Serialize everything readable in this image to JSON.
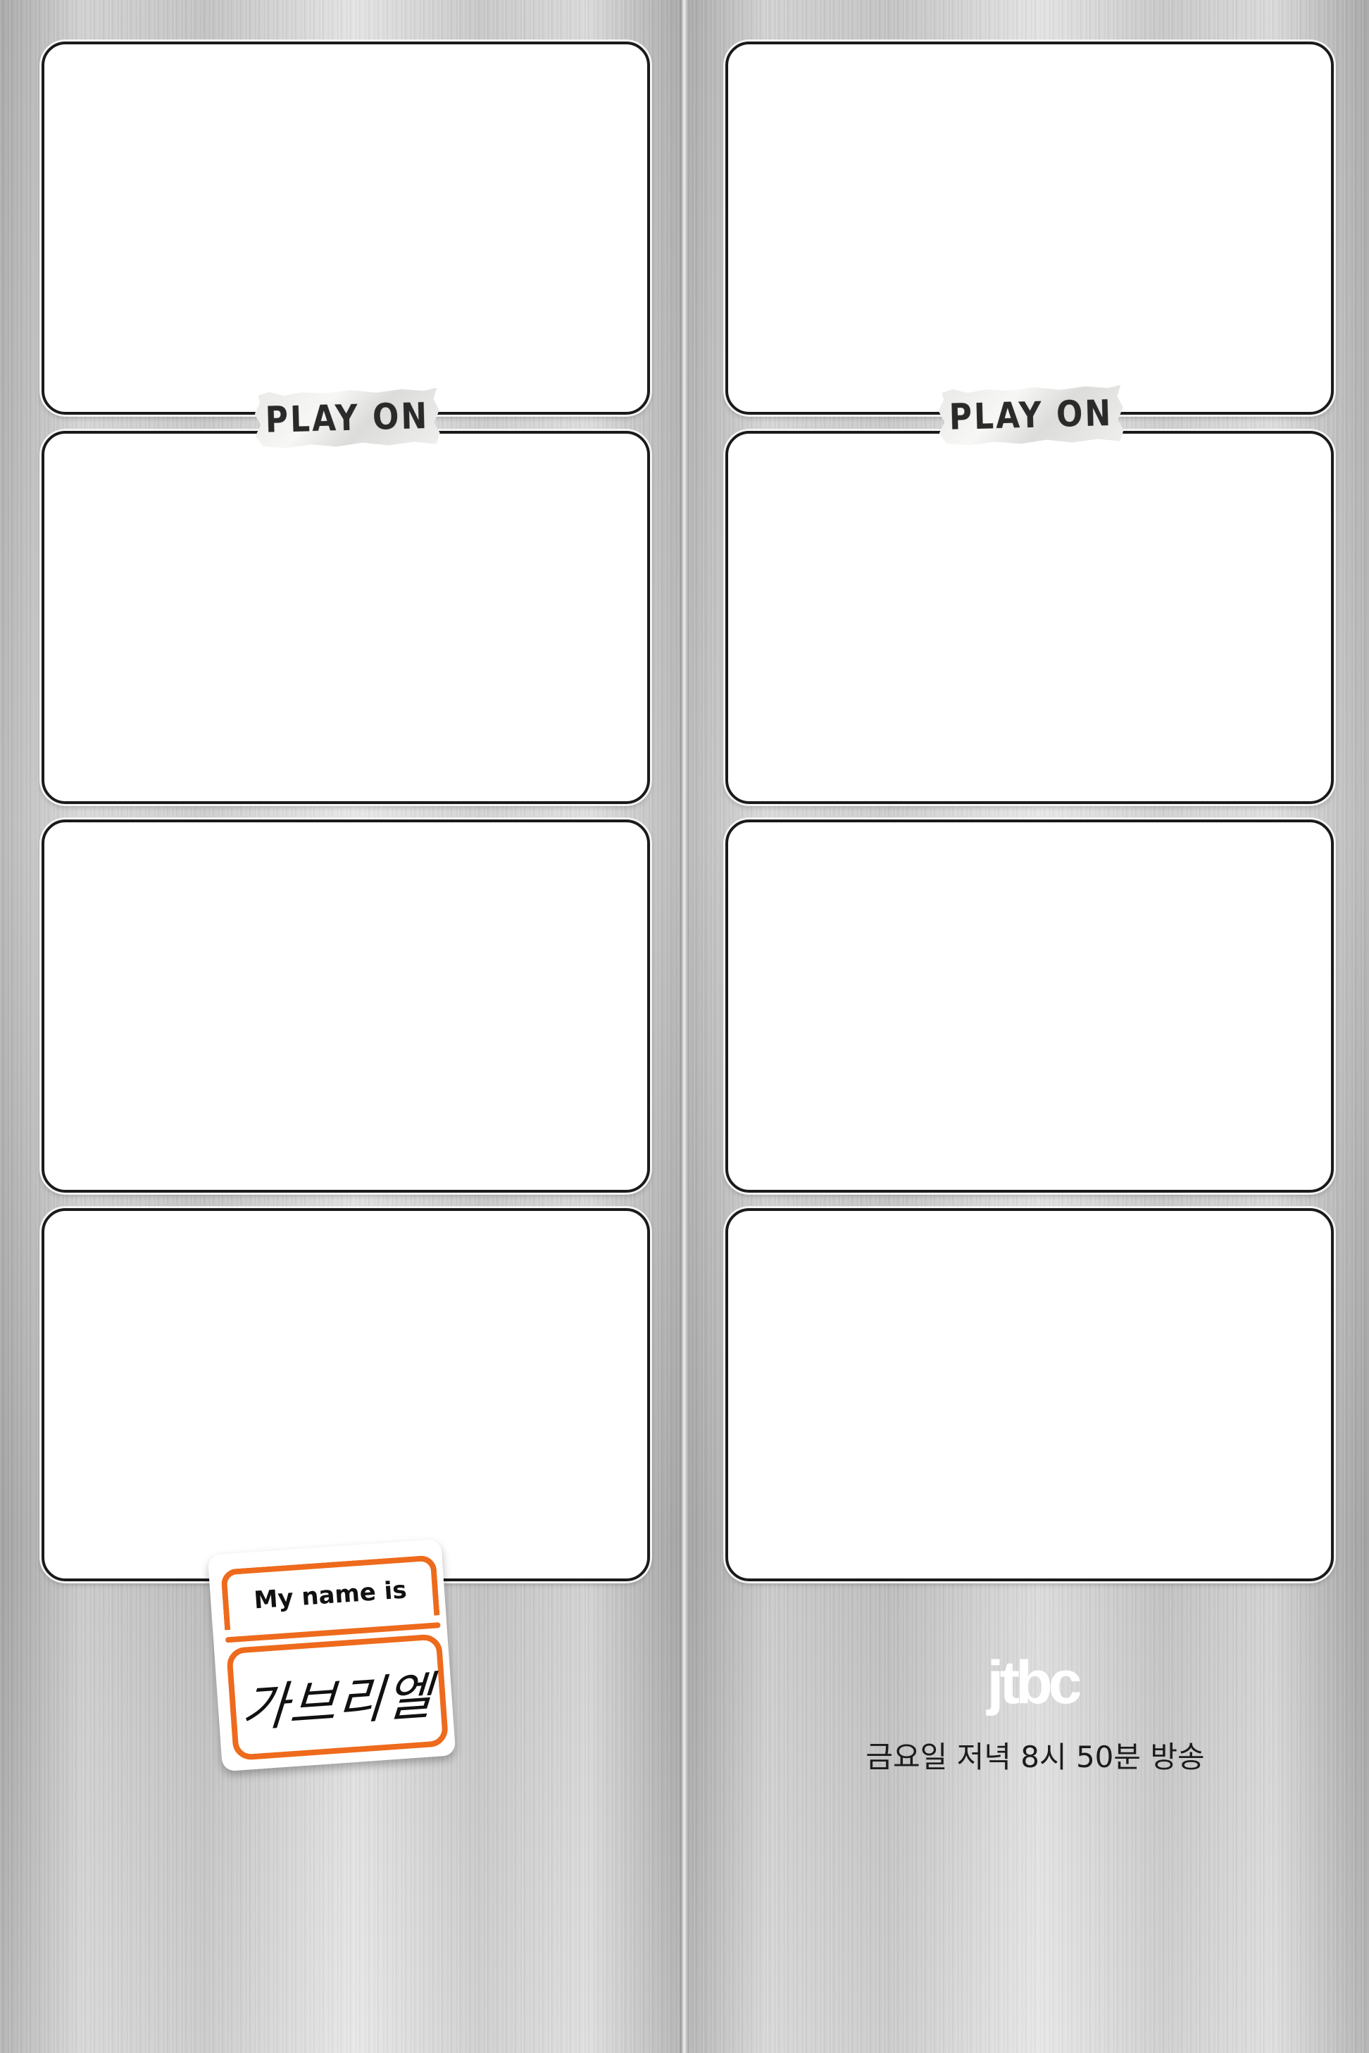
{
  "left_strip": {
    "tape_label": "PLAY ON",
    "nametag": {
      "top_text": "My name is",
      "name": "가브리엘"
    }
  },
  "right_strip": {
    "tape_label": "PLAY ON",
    "logo": "jtbc",
    "airtime": "금요일 저녁 8시 50분 방송"
  },
  "colors": {
    "nametag_accent": "#ee6a1c",
    "frame_border": "#1a1a1a",
    "frame_fill": "#ffffff"
  }
}
